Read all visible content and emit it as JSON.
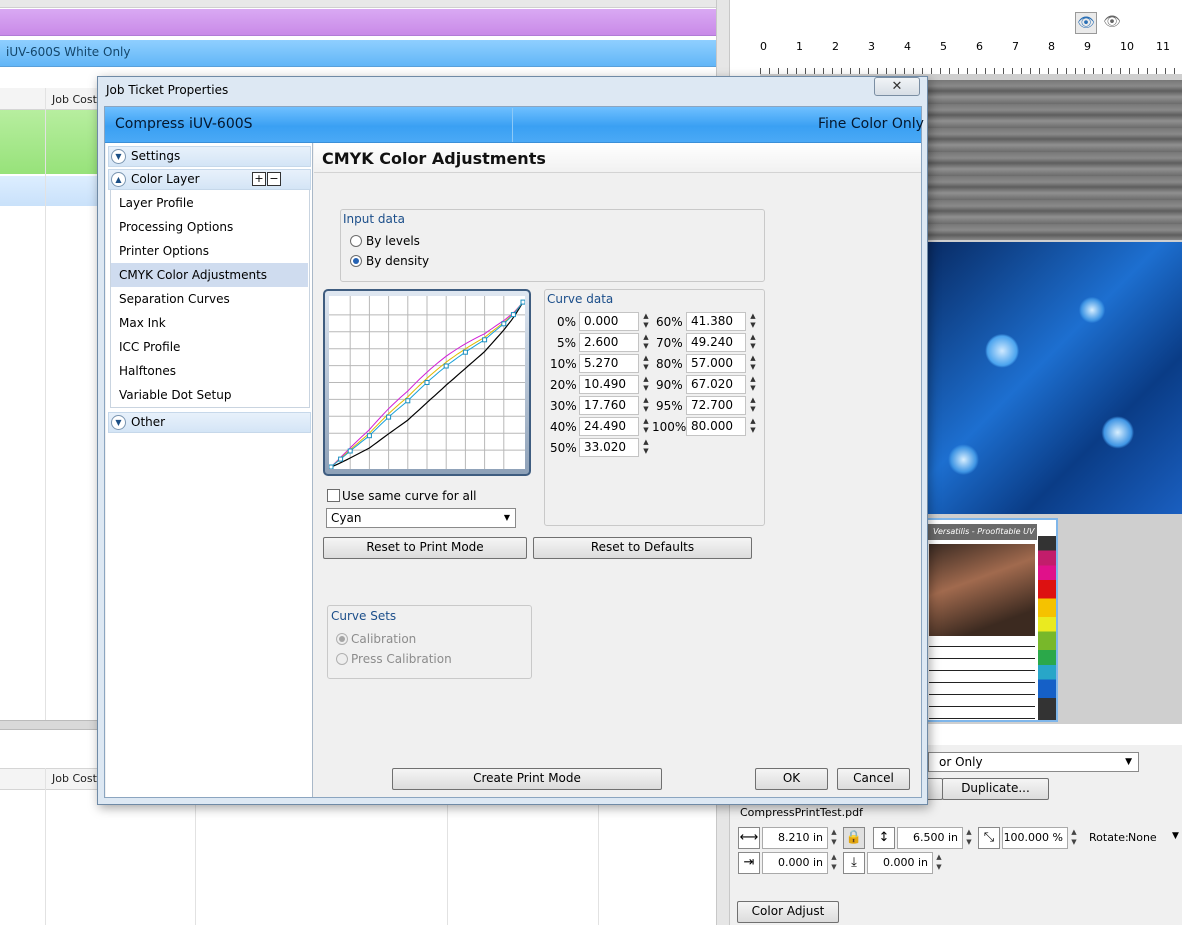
{
  "background": {
    "blue_row_label": "iUV-600S White Only",
    "grid_header_col": "Job Cost",
    "grid_header_col2": "Job Cost",
    "ruler_numbers": [
      "0",
      "1",
      "2",
      "3",
      "4",
      "5",
      "6",
      "7",
      "8",
      "9",
      "10",
      "11"
    ],
    "preview_sheet_title": "Versatilis - Proofitable UV Printing",
    "mode_select": "or Only",
    "duplicate_label": "Duplicate...",
    "file_name": "CompressPrintTest.pdf",
    "width_value": "8.210 in",
    "height_value": "6.500 in",
    "scale_value": "100.000 %",
    "rotate_label": "Rotate:",
    "rotate_value": "None",
    "offset_x": "0.000 in",
    "offset_y": "0.000 in",
    "color_adjust_label": "Color Adjust"
  },
  "dialog": {
    "title": "Job Ticket Properties",
    "close": "✕",
    "header_left": "Compress iUV-600S",
    "header_right": "Fine Color Only",
    "nav": {
      "settings": "Settings",
      "color_layer": "Color Layer",
      "items": [
        "Layer Profile",
        "Processing Options",
        "Printer Options",
        "CMYK Color Adjustments",
        "Separation Curves",
        "Max Ink",
        "ICC Profile",
        "Halftones",
        "Variable Dot Setup"
      ],
      "selected_index": 3,
      "other": "Other"
    },
    "content_title": "CMYK Color Adjustments",
    "input_data": {
      "legend": "Input data",
      "options": [
        "By levels",
        "By density"
      ],
      "selected": "By density"
    },
    "curve_data": {
      "legend": "Curve data",
      "left": [
        {
          "label": "0%",
          "value": "0.000"
        },
        {
          "label": "5%",
          "value": "2.600"
        },
        {
          "label": "10%",
          "value": "5.270"
        },
        {
          "label": "20%",
          "value": "10.490"
        },
        {
          "label": "30%",
          "value": "17.760"
        },
        {
          "label": "40%",
          "value": "24.490"
        },
        {
          "label": "50%",
          "value": "33.020"
        }
      ],
      "right": [
        {
          "label": "60%",
          "value": "41.380"
        },
        {
          "label": "70%",
          "value": "49.240"
        },
        {
          "label": "80%",
          "value": "57.000"
        },
        {
          "label": "90%",
          "value": "67.020"
        },
        {
          "label": "95%",
          "value": "72.700"
        },
        {
          "label": "100%",
          "value": "80.000"
        }
      ]
    },
    "same_curve_label": "Use same curve for all",
    "same_curve_checked": false,
    "channel": "Cyan",
    "reset_print_mode": "Reset to Print Mode",
    "reset_defaults": "Reset to Defaults",
    "curve_sets": {
      "legend": "Curve Sets",
      "options": [
        "Calibration",
        "Press Calibration"
      ],
      "selected": "Calibration"
    },
    "create_print_mode": "Create Print Mode",
    "ok": "OK",
    "cancel": "Cancel"
  }
}
